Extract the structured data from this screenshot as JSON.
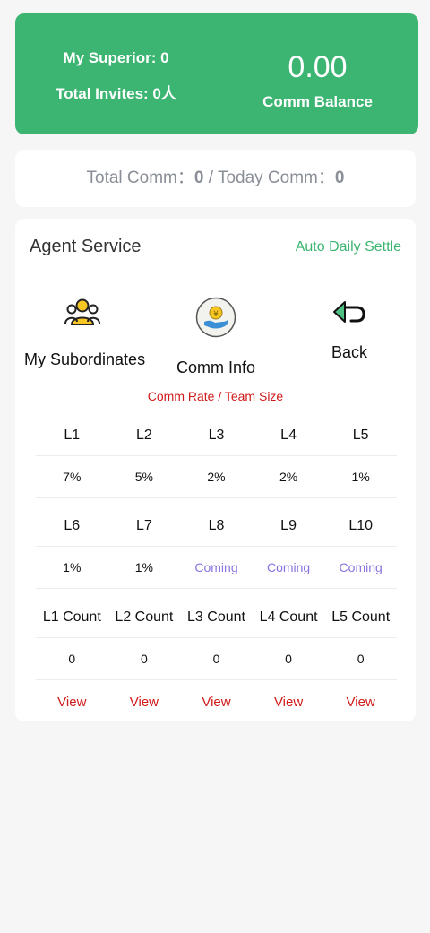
{
  "summary": {
    "superior_label": "My Superior: 0",
    "invites_label": "Total Invites: 0人",
    "balance_value": "0.00",
    "balance_label": "Comm Balance"
  },
  "comm": {
    "total_label": "Total Comm：",
    "total_value": "0",
    "sep": " / ",
    "today_label": "Today Comm：",
    "today_value": "0"
  },
  "agent": {
    "title": "Agent Service",
    "settle_label": "Auto Daily Settle",
    "services": [
      {
        "label": "My Subordinates",
        "icon": "group-icon"
      },
      {
        "label": "Comm Info",
        "icon": "money-hand-icon"
      },
      {
        "label": "Back",
        "icon": "back-arrow-icon"
      }
    ],
    "rate_title": "Comm Rate / Team Size",
    "levels_row1": [
      "L1",
      "L2",
      "L3",
      "L4",
      "L5"
    ],
    "rates_row1": [
      "7%",
      "5%",
      "2%",
      "2%",
      "1%"
    ],
    "levels_row2": [
      "L6",
      "L7",
      "L8",
      "L9",
      "L10"
    ],
    "rates_row2": [
      "1%",
      "1%",
      "Coming",
      "Coming",
      "Coming"
    ],
    "count_headers": [
      "L1 Count",
      "L2 Count",
      "L3 Count",
      "L4 Count",
      "L5 Count"
    ],
    "counts": [
      "0",
      "0",
      "0",
      "0",
      "0"
    ],
    "view_labels": [
      "View",
      "View",
      "View",
      "View",
      "View"
    ]
  },
  "colors": {
    "brand_green": "#3bb571",
    "accent_red": "#d11a1a",
    "coming_purple": "#8a72e0"
  }
}
